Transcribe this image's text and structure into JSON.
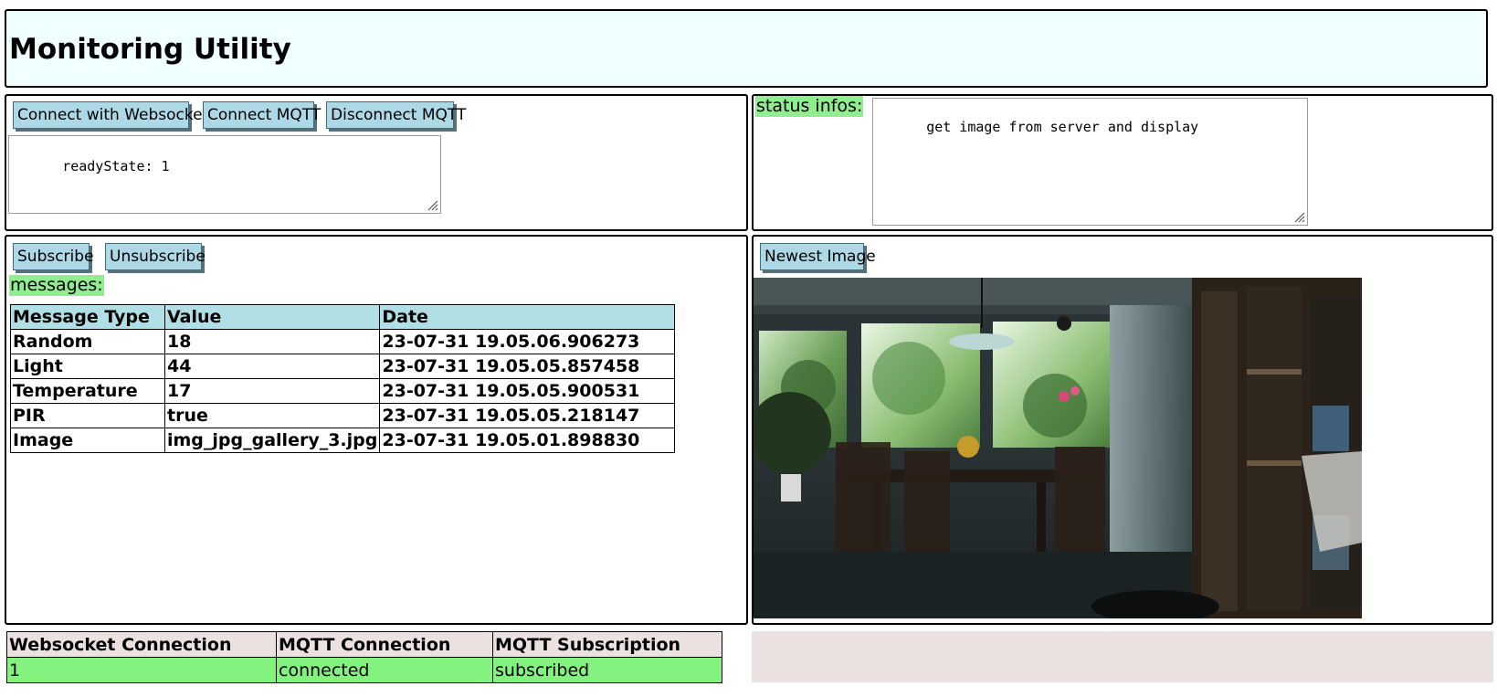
{
  "app": {
    "title": "Monitoring Utility"
  },
  "connection_panel": {
    "connect_websocket_label": "Connect with Websocket",
    "connect_mqtt_label": "Connect MQTT",
    "disconnect_mqtt_label": "Disconnect MQTT",
    "log_text": "readyState: 1"
  },
  "status_panel": {
    "label": "status infos:",
    "text": "get image from server and display"
  },
  "messages_panel": {
    "subscribe_label": "Subscribe",
    "unsubscribe_label": "Unsubscribe",
    "label": "messages:",
    "columns": [
      "Message Type",
      "Value",
      "Date"
    ],
    "rows": [
      [
        "Random",
        "18",
        "23-07-31 19.05.06.906273"
      ],
      [
        "Light",
        "44",
        "23-07-31 19.05.05.857458"
      ],
      [
        "Temperature",
        "17",
        "23-07-31 19.05.05.900531"
      ],
      [
        "PIR",
        "true",
        "23-07-31 19.05.05.218147"
      ],
      [
        "Image",
        "img_jpg_gallery_3.jpg",
        "23-07-31 19.05.01.898830"
      ]
    ]
  },
  "image_panel": {
    "newest_image_label": "Newest Image"
  },
  "connection_status": {
    "columns": [
      "Websocket Connection",
      "MQTT Connection",
      "MQTT Subscription"
    ],
    "values": [
      "1",
      "connected",
      "subscribed"
    ]
  },
  "colors": {
    "header_bg": "#f0ffff",
    "button_bg": "#add8e6",
    "label_green": "#90ee90",
    "table_header_bg": "#b0e0e6",
    "status_green": "#83f27e",
    "footer_bg": "#ece1e1"
  }
}
